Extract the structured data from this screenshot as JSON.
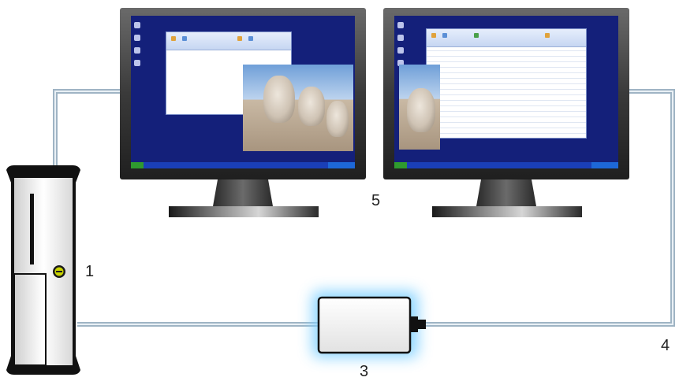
{
  "callouts": {
    "pc": "1",
    "adapter": "3",
    "cable": "4",
    "monitors": "5"
  },
  "icons": {
    "pc": "desktop-tower-icon",
    "adapter": "usb-display-adapter-icon",
    "monitor": "monitor-icon",
    "power": "power-button-icon"
  },
  "colors": {
    "cable": "#9fb4c4",
    "screen": "#14207a",
    "adapter_glow": "#7fd0ff",
    "power": "#c9d400"
  }
}
